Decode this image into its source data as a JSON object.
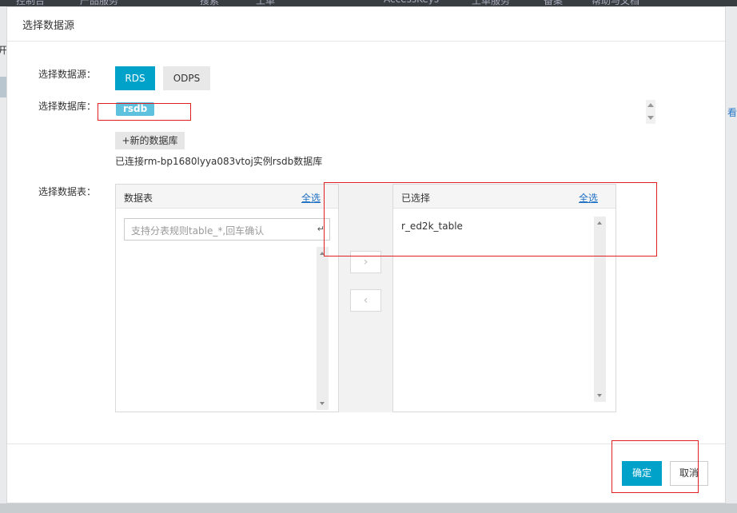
{
  "background": {
    "topbar_items": [
      "控制台",
      "产品服务",
      "搜索",
      "工单",
      "AccessKeys",
      "工单服务",
      "备案",
      "帮助与文档"
    ],
    "left_fragment": "开",
    "right_fragment": "看"
  },
  "dialog": {
    "title": "选择数据源",
    "source": {
      "label": "选择数据源：",
      "options": [
        "RDS",
        "ODPS"
      ],
      "selected": "RDS"
    },
    "database": {
      "label": "选择数据库：",
      "selected_tag": "rsdb",
      "new_button": "+新的数据库",
      "connected_text": "已连接rm-bp1680lyya083vtoj实例rsdb数据库"
    },
    "tables": {
      "label": "选择数据表：",
      "left_panel": {
        "title": "数据表",
        "select_all": "全选",
        "search_placeholder": "支持分表规则table_*,回车确认",
        "items": []
      },
      "right_panel": {
        "title": "已选择",
        "select_all": "全选",
        "items": [
          "r_ed2k_table"
        ]
      },
      "move_right": "›",
      "move_left": "‹"
    },
    "footer": {
      "ok": "确定",
      "cancel": "取消"
    }
  },
  "colors": {
    "primary": "#00a2ca",
    "tag": "#5ec1de",
    "annotation": "#e02020",
    "link": "#1b6ec2"
  }
}
